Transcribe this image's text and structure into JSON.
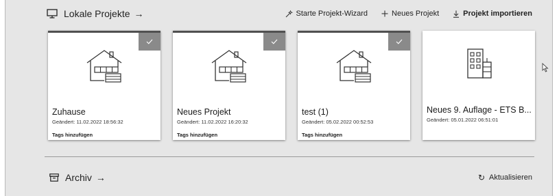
{
  "header": {
    "title": "Lokale Projekte",
    "title_arrow": "→",
    "actions": {
      "wizard": "Starte Projekt-Wizard",
      "new_project": "Neues Projekt",
      "import": "Projekt importieren"
    }
  },
  "projects": [
    {
      "title": "Zuhause",
      "modified": "Geändert: 11.02.2022 18:56:32",
      "tags": "Tags hinzufügen",
      "selected": true,
      "icon": "house-icon"
    },
    {
      "title": "Neues Projekt",
      "modified": "Geändert: 11.02.2022 16:20:32",
      "tags": "Tags hinzufügen",
      "selected": true,
      "icon": "house-icon"
    },
    {
      "title": "test (1)",
      "modified": "Geändert: 05.02.2022 00:52:53",
      "tags": "Tags hinzufügen",
      "selected": true,
      "icon": "house-icon"
    },
    {
      "title": "Neues 9. Auflage - ETS B...",
      "modified": "Geändert: 05.01.2022 06:51:01",
      "tags": "",
      "selected": false,
      "icon": "office-building-icon"
    }
  ],
  "archive": {
    "title": "Archiv",
    "title_arrow": "→",
    "refresh": "Aktualisieren",
    "refresh_icon": "↻"
  }
}
